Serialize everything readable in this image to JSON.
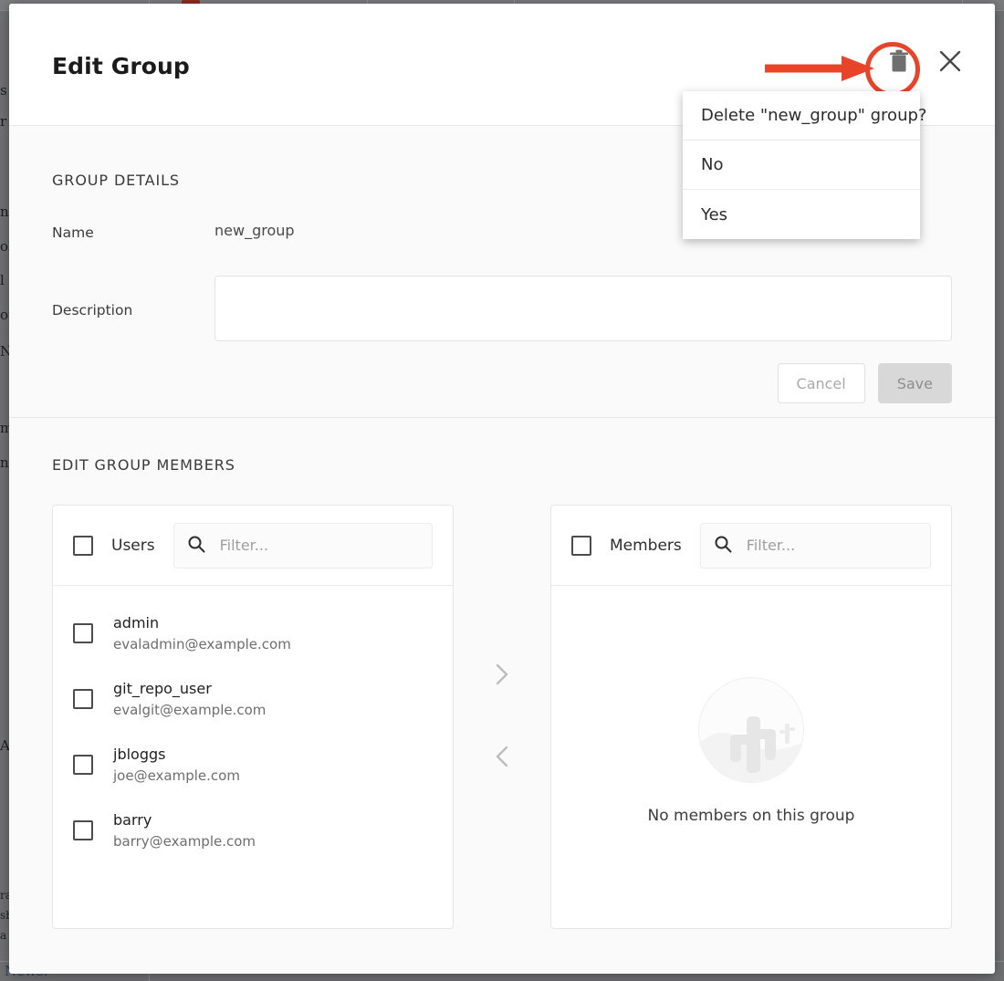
{
  "background": {
    "left_text_fragments": [
      "s",
      "r",
      "ng",
      "ol",
      "l",
      "ot",
      "N",
      "m",
      "n",
      "A",
      "ra",
      "sh",
      "a"
    ],
    "footer_link": "News."
  },
  "modal": {
    "title": "Edit Group",
    "header_icons": {
      "delete": "trash-icon",
      "close": "close-icon"
    },
    "annotation": {
      "color": "#e8442a",
      "arrow": "arrow-right-annotation",
      "circle": "highlight-circle-annotation"
    }
  },
  "delete_menu": {
    "prompt": "Delete \"new_group\" group?",
    "no_label": "No",
    "yes_label": "Yes"
  },
  "group_details": {
    "heading": "GROUP DETAILS",
    "name_label": "Name",
    "name_value": "new_group",
    "description_label": "Description",
    "description_value": "",
    "cancel_label": "Cancel",
    "save_label": "Save"
  },
  "members_section": {
    "heading": "EDIT GROUP MEMBERS",
    "users_panel": {
      "title": "Users",
      "filter_placeholder": "Filter...",
      "filter_value": "",
      "users": [
        {
          "name": "admin",
          "email": "evaladmin@example.com"
        },
        {
          "name": "git_repo_user",
          "email": "evalgit@example.com"
        },
        {
          "name": "jbloggs",
          "email": "joe@example.com"
        },
        {
          "name": "barry",
          "email": "barry@example.com"
        }
      ]
    },
    "transfer": {
      "add_icon": "chevron-right-icon",
      "remove_icon": "chevron-left-icon"
    },
    "members_panel": {
      "title": "Members",
      "filter_placeholder": "Filter...",
      "filter_value": "",
      "empty_text": "No members on this group",
      "empty_illustration": "desert-cactus-illustration",
      "members": []
    }
  }
}
